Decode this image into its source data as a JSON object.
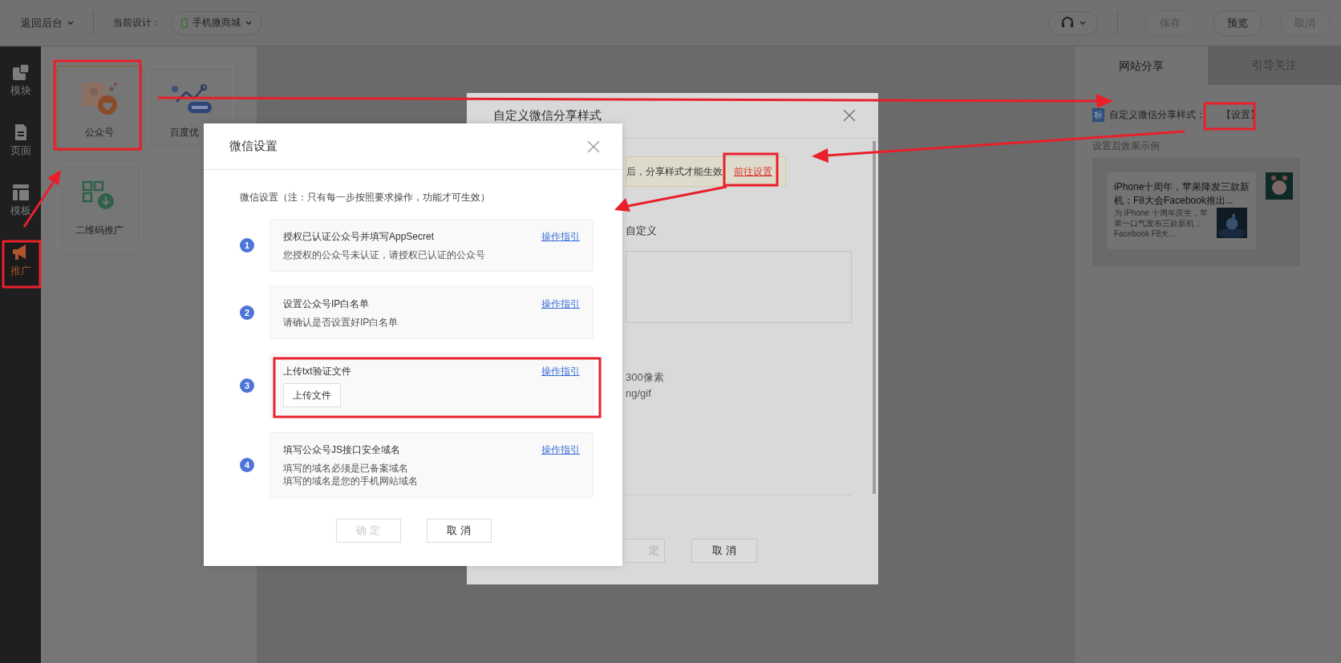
{
  "top_bar": {
    "back": "返回后台",
    "design_label": "当前设计：",
    "design_name": "手机微商城",
    "buttons": [
      {
        "label": "保存",
        "disabled": true
      },
      {
        "label": "预览",
        "disabled": false
      },
      {
        "label": "取消",
        "disabled": true
      }
    ]
  },
  "sidebar": {
    "items": [
      {
        "label": "模块",
        "kind": "module",
        "selected": false
      },
      {
        "label": "页面",
        "kind": "page",
        "selected": false
      },
      {
        "label": "模板",
        "kind": "template",
        "selected": false
      },
      {
        "label": "推广",
        "kind": "promote",
        "selected": true
      }
    ]
  },
  "tiles": [
    {
      "label": "公众号",
      "kind": "heart",
      "selected": true
    },
    {
      "label": "百度优",
      "kind": "seo",
      "selected": false
    },
    {
      "label": "二维码推广",
      "kind": "qr",
      "selected": false
    }
  ],
  "share_dialog": {
    "title": "自定义微信分享样式",
    "notice": "后，分享样式才能生效",
    "notice_link": "前往设置",
    "option": "自定义",
    "size_hint": "300像素",
    "format_hint": "ng/gif",
    "buttons": [
      "定",
      "取 消"
    ]
  },
  "wechat_dialog": {
    "title": "微信设置",
    "note": "微信设置（注：只有每一步按照要求操作，功能才可生效）",
    "steps": [
      {
        "number": "1",
        "title": "授权已认证公众号并填写AppSecret",
        "lines": [
          "您授权的公众号未认证，请授权已认证的公众号"
        ],
        "link": "操作指引"
      },
      {
        "number": "2",
        "title": "设置公众号IP白名单",
        "lines": [
          "请确认是否设置好IP白名单"
        ],
        "link": "操作指引"
      },
      {
        "number": "3",
        "title": "上传txt验证文件",
        "button": "上传文件",
        "link": "操作指引"
      },
      {
        "number": "4",
        "title": "填写公众号JS接口安全域名",
        "lines": [
          "填写的域名必须是已备案域名",
          "填写的域名是您的手机网站域名"
        ],
        "link": "操作指引"
      }
    ],
    "buttons": [
      {
        "label": "确 定",
        "disabled": true
      },
      {
        "label": "取 消",
        "disabled": false
      }
    ]
  },
  "right_panel": {
    "tabs": [
      {
        "label": "网站分享",
        "selected": true
      },
      {
        "label": "引导关注",
        "selected": false
      }
    ],
    "badge": "标",
    "setting_label": "自定义微信分享样式：",
    "setting_link": "【设置】",
    "preview_label": "设置后效果示例",
    "preview_title": "iPhone十周年，苹果降发三款新机；F8大会Facebook推出...",
    "preview_desc": "为 iPhone 十周年庆生，苹果一口气发布三款新机；Facebook F8大..."
  }
}
